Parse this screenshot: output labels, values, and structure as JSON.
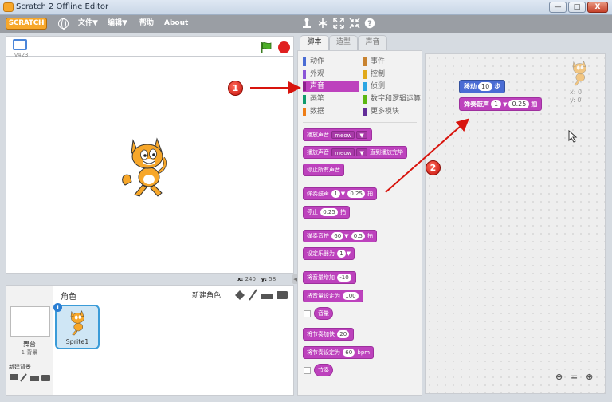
{
  "window": {
    "title": "Scratch 2 Offline Editor",
    "btn_minimize": "—",
    "btn_maximize": "□",
    "btn_close": "X"
  },
  "menubar": {
    "logo": "SCRATCH",
    "file": "文件▼",
    "edit": "编辑▼",
    "help": "帮助",
    "about": "About"
  },
  "stage": {
    "version": "v423",
    "x_label": "x:",
    "x_value": "240",
    "y_label": "y:",
    "y_value": "58"
  },
  "sprites": {
    "header": "角色",
    "new_sprite": "新建角色:",
    "stage_label": "舞台",
    "backdrop_count": "1 背景",
    "new_backdrop": "新建背景",
    "sprite_name": "Sprite1"
  },
  "tabs": [
    "脚本",
    "造型",
    "声音"
  ],
  "categories_left": [
    "动作",
    "外观",
    "声音",
    "画笔",
    "数据"
  ],
  "categories_right": [
    "事件",
    "控制",
    "侦测",
    "数字和逻辑运算",
    "更多模块"
  ],
  "category_colors": {
    "动作": "#4a6cd4",
    "外观": "#8a55d7",
    "声音": "#bd42bd",
    "画笔": "#0e9a6c",
    "数据": "#ee7d16",
    "事件": "#c88330",
    "控制": "#e1a91a",
    "侦测": "#2ca5e2",
    "数字和逻辑运算": "#5cb712",
    "更多模块": "#632d99"
  },
  "palette": {
    "play_sound": "播放声音",
    "sound_meow": "meow",
    "play_until_done": "直到播放完毕",
    "stop_all_sounds": "停止所有声音",
    "play_drum": "弹奏鼓声",
    "drum_num": "1",
    "drum_beats": "0.25",
    "beats": "拍",
    "rest_for": "停止",
    "rest_beats": "0.25",
    "play_note": "弹奏音符",
    "note_num": "60",
    "note_beats": "0.5",
    "set_instrument": "设定乐器为",
    "instrument_num": "1",
    "change_volume": "将音量增加",
    "volume_delta": "-10",
    "set_volume": "将音量设定为",
    "volume_value": "100",
    "volume": "音量",
    "change_tempo": "将节奏加快",
    "tempo_delta": "20",
    "set_tempo": "将节奏设定为",
    "tempo_value": "60",
    "bpm": "bpm",
    "tempo": "节奏"
  },
  "script": {
    "move_label": "移动",
    "move_steps": "10",
    "steps": "步",
    "drum_label": "弹奏鼓声",
    "drum_num": "1",
    "drum_beats": "0.25",
    "beats": "拍",
    "sprite_x": "x: 0",
    "sprite_y": "y: 0",
    "zoom_controls": "⊖ = ⊕"
  },
  "annotations": [
    "1",
    "2"
  ],
  "colors": {
    "sound_block": "#bd42bd",
    "motion_block": "#4a6cd4",
    "annotation": "#d8140d",
    "selected_sprite": "#3a9bd8"
  }
}
